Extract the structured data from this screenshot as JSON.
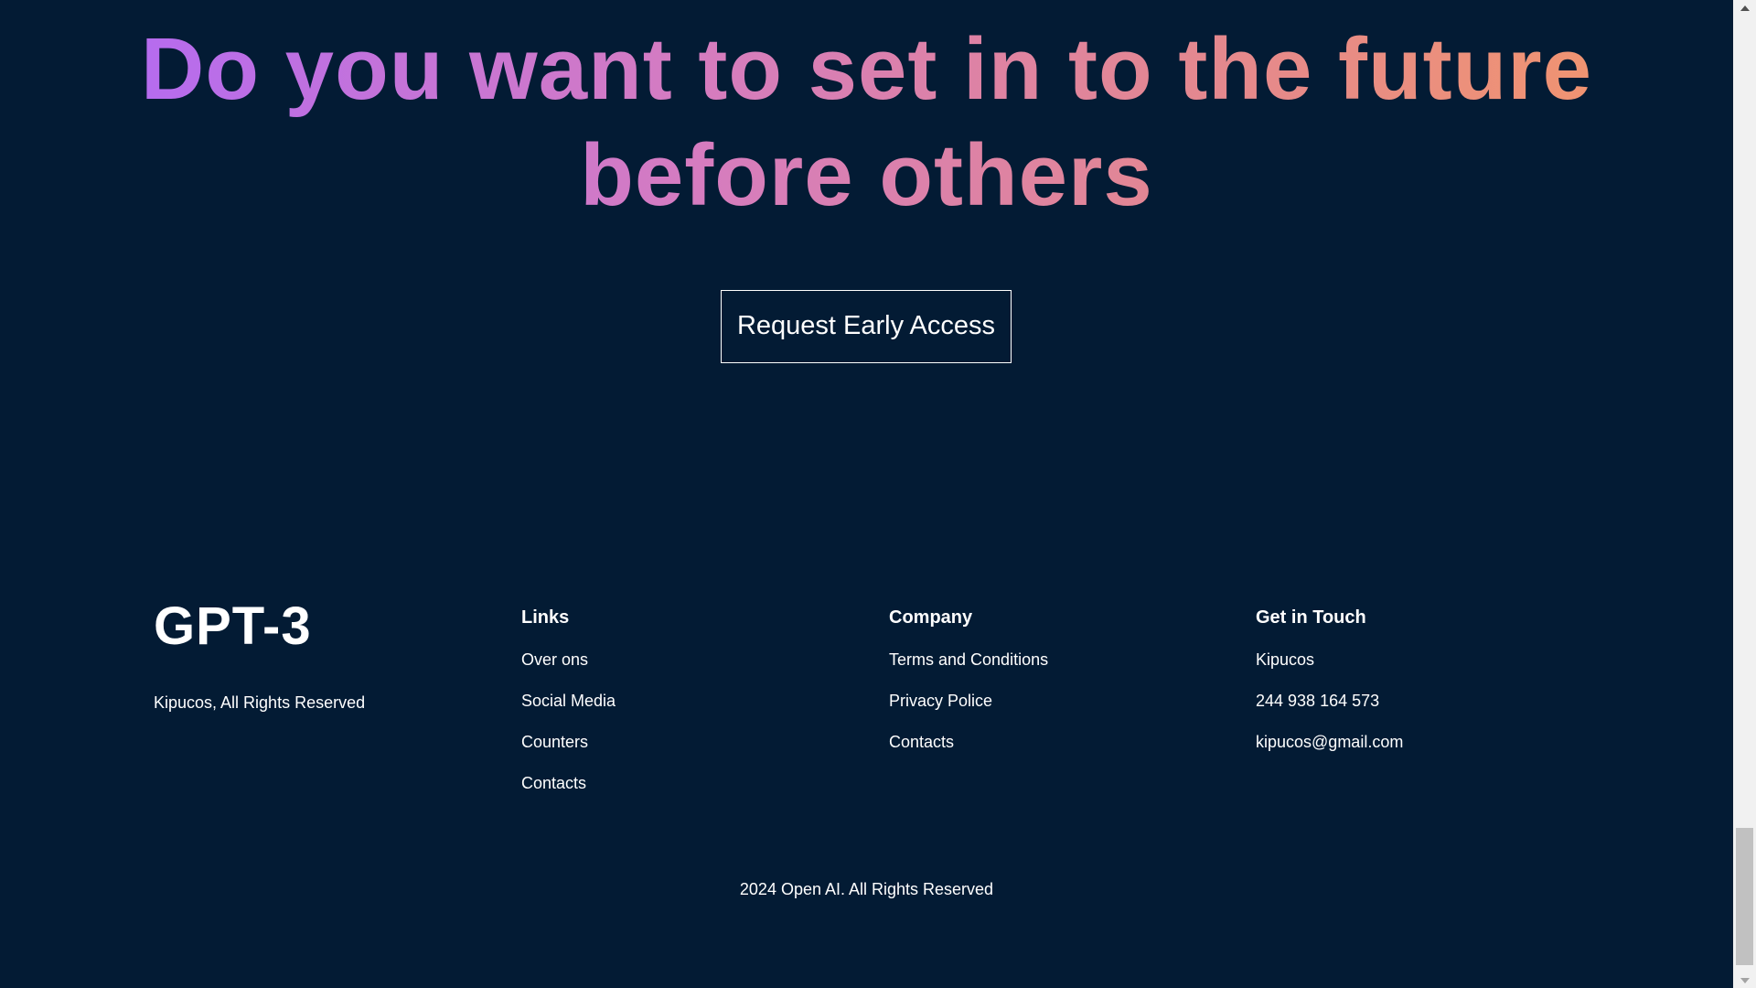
{
  "cta": {
    "heading": "Do you want to set in to the future before others",
    "button_label": "Request Early Access"
  },
  "footer": {
    "brand": {
      "logo_text": "GPT-3",
      "copyright": "Kipucos, All Rights Reserved"
    },
    "links": {
      "title": "Links",
      "items": [
        "Over ons",
        "Social Media",
        "Counters",
        "Contacts"
      ]
    },
    "company": {
      "title": "Company",
      "items": [
        "Terms and Conditions",
        "Privacy Police",
        "Contacts"
      ]
    },
    "contact": {
      "title": "Get in Touch",
      "items": [
        "Kipucos",
        "244 938 164 573",
        "kipucos@gmail.com"
      ]
    },
    "bottom_copyright": "2024 Open AI. All Rights Reserved"
  },
  "colors": {
    "background": "#031b34",
    "gradient_start": "#ae67fa",
    "gradient_end": "#f49867",
    "text": "#ffffff"
  }
}
